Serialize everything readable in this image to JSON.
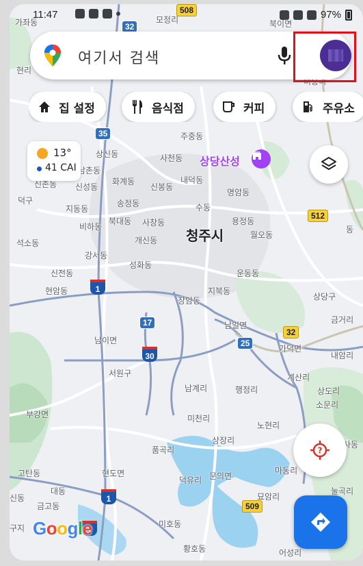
{
  "status_bar": {
    "time": "11:47",
    "battery": "97%"
  },
  "search": {
    "placeholder": "여기서 검색"
  },
  "chips": [
    {
      "label": "집 설정",
      "icon": "home-icon"
    },
    {
      "label": "음식점",
      "icon": "restaurant-icon"
    },
    {
      "label": "커피",
      "icon": "coffee-icon"
    },
    {
      "label": "주유소",
      "icon": "gas-station-icon"
    }
  ],
  "weather": {
    "temp": "13°",
    "air_quality": "41 CAI"
  },
  "map": {
    "city": "청주시",
    "poi": "상당산성",
    "places": [
      "가좌동",
      "모정리",
      "북이면",
      "현리",
      "비홍리",
      "주중동",
      "35",
      "상신동",
      "사천동",
      "남촌동",
      "화계동",
      "내덕동",
      "신촌동",
      "신성동",
      "신봉동",
      "명암동",
      "덕구",
      "송정동",
      "지동동",
      "수동",
      "북대동",
      "사창동",
      "용정동",
      "비하동",
      "청주시",
      "월오동",
      "석소동",
      "개신동",
      "강서동",
      "성화동",
      "운동동",
      "신전동",
      "현암동",
      "지북동",
      "상당구",
      "장암동",
      "남일면",
      "금거리",
      "가덕면",
      "내암리",
      "남이면",
      "서원구",
      "계산리",
      "남계리",
      "행정리",
      "부강면",
      "미천리",
      "노현리",
      "상장리",
      "품곡리",
      "마동리",
      "고탄동",
      "대동",
      "현도면",
      "덕유리",
      "문의면",
      "묘암리",
      "금고동",
      "신동",
      "미호동",
      "황호동",
      "어성리",
      "눌곡리",
      "상도리",
      "소문리",
      "사동",
      "동",
      "구지"
    ],
    "routes": [
      "508",
      "32",
      "35",
      "512",
      "1",
      "17",
      "25",
      "32",
      "30",
      "1",
      "509",
      "1"
    ]
  },
  "brand": {
    "logo": "Google"
  }
}
